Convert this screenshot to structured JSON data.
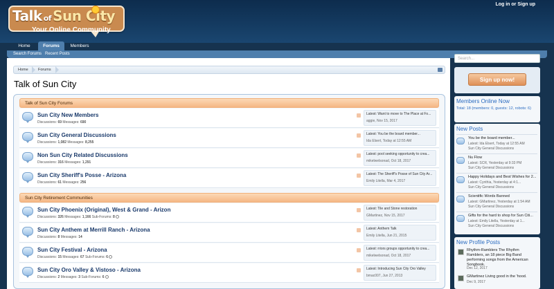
{
  "header": {
    "logo": {
      "title_a": "Talk",
      "title_of": "of",
      "title_b": "Sun City",
      "tagline": "Your Online Community"
    },
    "login_link": "Log in or Sign up"
  },
  "nav": {
    "tabs": [
      {
        "label": "Home"
      },
      {
        "label": "Forums"
      },
      {
        "label": "Members"
      }
    ],
    "sub": [
      {
        "label": "Search Forums"
      },
      {
        "label": "Recent Posts"
      }
    ]
  },
  "breadcrumb": [
    "Home",
    "Forums"
  ],
  "page_title": "Talk of Sun City",
  "categories": [
    {
      "title": "Talk of Sun City Forums",
      "nodes": [
        {
          "title": "Sun City New Members",
          "discussions": "69",
          "messages": "690",
          "subforums": "",
          "last_title": "Latest: Want to move to The Place at Fo...",
          "last_meta": "aggie, Nov 15, 2017"
        },
        {
          "title": "Sun City General Discussions",
          "discussions": "1,082",
          "messages": "8,255",
          "subforums": "",
          "last_title": "Latest: You be the board member...",
          "last_meta": "Ida Elsert, Today at 12:55 AM"
        },
        {
          "title": "Non Sun City Related Discussions",
          "discussions": "316",
          "messages": "1,291",
          "subforums": "",
          "last_title": "Latest: pool seeking opportunity to crea...",
          "last_meta": "mikelwelsonad, Oct 18, 2017"
        },
        {
          "title": "Sun City Sheriff's Posse - Arizona",
          "discussions": "61",
          "messages": "256",
          "subforums": "",
          "last_title": "Latest: The Sheriff's Posse of Sun City Ar...",
          "last_meta": "Emily Litella, Mar 4, 2017"
        }
      ]
    },
    {
      "title": "Sun City Retirement Communities",
      "nodes": [
        {
          "title": "Sun City Phoenix (Original), West & Grand - Arizon",
          "discussions": "326",
          "messages": "1,166",
          "subforums": "8",
          "last_title": "Latest: Tile and Stone restoration",
          "last_meta": "GMartinez, Nov 15, 2017"
        },
        {
          "title": "Sun City Anthem at Merrill Ranch - Arizona",
          "discussions": "8",
          "messages": "14",
          "subforums": "",
          "last_title": "Latest: Anthem Talk",
          "last_meta": "Emily Litella, Jun 21, 2015"
        },
        {
          "title": "Sun City Festival - Arizona",
          "discussions": "15",
          "messages": "67",
          "subforums": "6",
          "last_title": "Latest: rriors groups opportunity to crea...",
          "last_meta": "mikelwelsonad, Oct 18, 2017"
        },
        {
          "title": "Sun City Oro Valley & Vistoso - Arizona",
          "discussions": "2",
          "messages": "3",
          "subforums": "6",
          "last_title": "Latest: Introducing Sun City Oro Valley",
          "last_meta": "bmac007, Jun 27, 2013"
        }
      ]
    }
  ],
  "labels": {
    "discussions": "Discussions:",
    "messages": "Messages:",
    "subforums": "Sub-Forums:"
  },
  "sidebar": {
    "search_placeholder": "Search...",
    "signup": "Sign up now!",
    "members_online": {
      "heading": "Members Online Now",
      "text": "Total: 18 (members: 0, guests: 12, robots: 6)"
    },
    "new_posts": {
      "heading": "New Posts",
      "items": [
        {
          "title": "You be the board member...",
          "meta": "Latest: Ida Elsert, Today at 12:55 AM",
          "forum": "Sun City General Discussions"
        },
        {
          "title": "Nu Flow",
          "meta": "Latest: SCR, Yesterday at 9:33 PM",
          "forum": "Sun City General Discussions"
        },
        {
          "title": "Happy Holidays and Best Wishes for 2...",
          "meta": "Latest: Cynthia, Yesterday at 4:1...",
          "forum": "Sun City General Discussions"
        },
        {
          "title": "Scientific Words Banned",
          "meta": "Latest: GMartinez, Yesterday at 1:54 AM",
          "forum": "Sun City General Discussions"
        },
        {
          "title": "Gifts for the hard to shop for Sun Citi...",
          "meta": "Latest: Emily Litella, Yesterday at 1...",
          "forum": "Sun City General Discussions"
        }
      ]
    },
    "profile_posts": {
      "heading": "New Profile Posts",
      "items": [
        {
          "text": "Rhythm-Ramblers The Rhythm Ramblers, an 18 piece Big Band performing songs from the American Songbook.",
          "date": "Dec 12, 2017"
        },
        {
          "text": "GMartinez Living good in the 'hood.",
          "date": "Dec 9, 2017"
        }
      ]
    }
  }
}
